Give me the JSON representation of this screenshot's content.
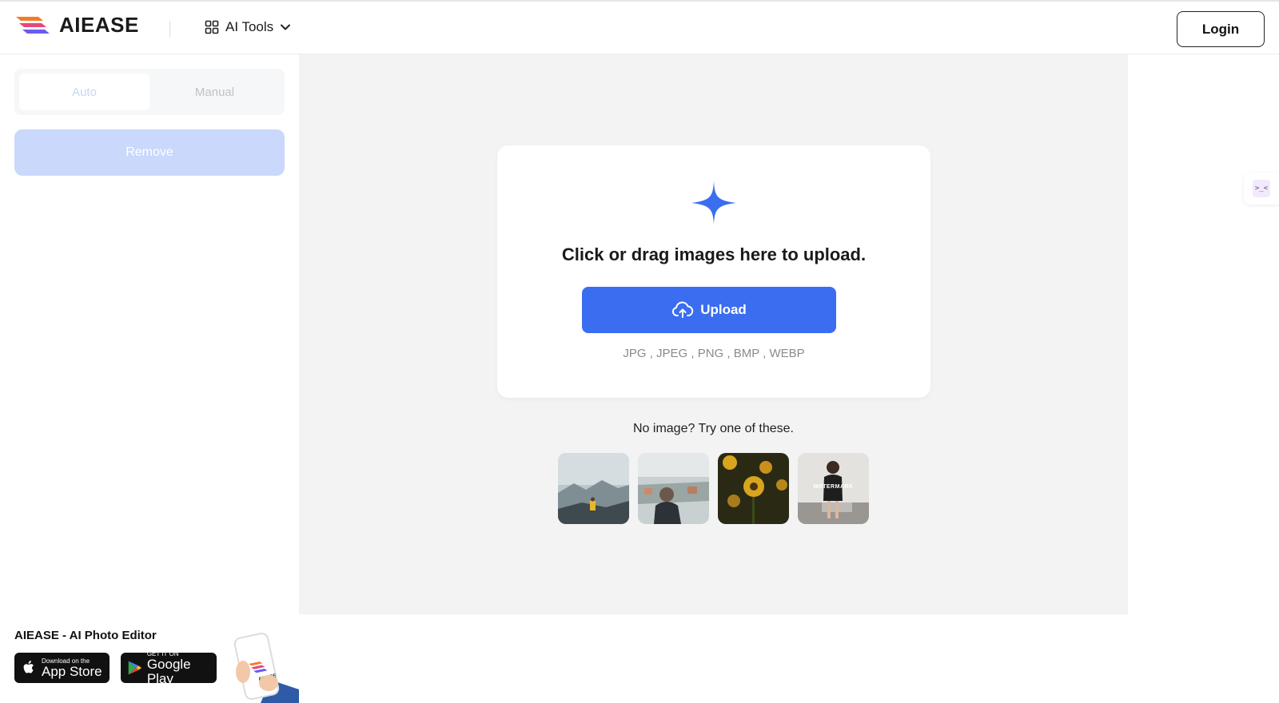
{
  "header": {
    "brand": "AIEASE",
    "tools_label": "AI Tools",
    "login_label": "Login"
  },
  "sidebar": {
    "tabs": [
      {
        "label": "Auto",
        "active": true
      },
      {
        "label": "Manual",
        "active": false
      }
    ],
    "remove_label": "Remove"
  },
  "upload": {
    "heading": "Click or drag images here to upload.",
    "button_label": "Upload",
    "formats": "JPG , JPEG , PNG , BMP , WEBP"
  },
  "samples": {
    "prompt": "No image? Try one of these.",
    "watermark_text": "WATERMARK"
  },
  "footer": {
    "title": "AIEASE - AI Photo Editor",
    "appstore_small": "Download on the",
    "appstore_big": "App Store",
    "gplay_small": "GET IT ON",
    "gplay_big": "Google Play",
    "phone_brand": "AIEASE"
  },
  "colors": {
    "accent": "#3a6df0",
    "remove_disabled": "#c9d8fb",
    "canvas_bg": "#f3f3f3"
  }
}
